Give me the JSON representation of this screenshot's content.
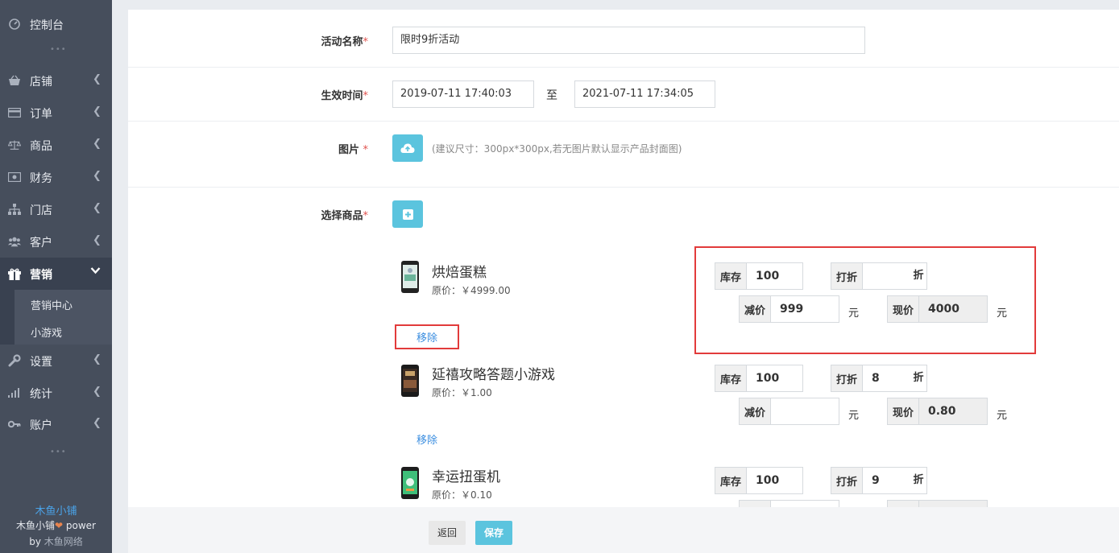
{
  "sidebar": {
    "console": {
      "label": "控制台",
      "icon": "dashboard-icon"
    },
    "items": [
      {
        "label": "店铺",
        "icon": "shop-basket-icon"
      },
      {
        "label": "订单",
        "icon": "order-card-icon"
      },
      {
        "label": "商品",
        "icon": "scale-icon"
      },
      {
        "label": "财务",
        "icon": "money-icon"
      },
      {
        "label": "门店",
        "icon": "sitemap-icon"
      },
      {
        "label": "客户",
        "icon": "users-icon"
      },
      {
        "label": "营销",
        "icon": "gift-icon"
      },
      {
        "label": "设置",
        "icon": "wrench-icon"
      },
      {
        "label": "统计",
        "icon": "bar-signal-icon"
      },
      {
        "label": "账户",
        "icon": "key-icon"
      }
    ],
    "submenu": [
      {
        "label": "营销中心"
      },
      {
        "label": "小游戏"
      }
    ],
    "brand": {
      "name": "木鱼小铺",
      "power_prefix": "木鱼小铺",
      "power_suffix": " power",
      "by_prefix": "by ",
      "by_company": "木鱼网络"
    }
  },
  "form": {
    "name_label": "活动名称",
    "name_value": "限时9折活动",
    "time_label": "生效时间",
    "time_start": "2019-07-11 17:40:03",
    "time_sep": "至",
    "time_end": "2021-07-11 17:34:05",
    "image_label": "图片",
    "image_hint": "(建议尺寸：300px*300px,若无图片默认显示产品封面图)",
    "goods_label": "选择商品",
    "required_mark": "*"
  },
  "products": [
    {
      "name": "烘焙蛋糕",
      "price": "原价：￥4999.00",
      "remove": "移除",
      "stock_label": "库存",
      "stock": "100",
      "discount_label": "打折",
      "discount": "",
      "discount_suffix": "折",
      "reduce_label": "减价",
      "reduce": "999",
      "currency": "元",
      "now_label": "现价",
      "now": "4000"
    },
    {
      "name": "延禧攻略答题小游戏",
      "price": "原价：￥1.00",
      "remove": "移除",
      "stock_label": "库存",
      "stock": "100",
      "discount_label": "打折",
      "discount": "8",
      "discount_suffix": "折",
      "reduce_label": "减价",
      "reduce": "",
      "currency": "元",
      "now_label": "现价",
      "now": "0.80"
    },
    {
      "name": "幸运扭蛋机",
      "price": "原价：￥0.10",
      "stock_label": "库存",
      "stock": "100",
      "discount_label": "打折",
      "discount": "9",
      "discount_suffix": "折"
    }
  ],
  "footer": {
    "back": "返回",
    "save": "保存"
  },
  "colors": {
    "sidebar_bg": "#464e5c",
    "accent": "#5bc4de",
    "link": "#3b8ee0",
    "highlight_box": "#e23b3b",
    "required": "#e0524e"
  }
}
